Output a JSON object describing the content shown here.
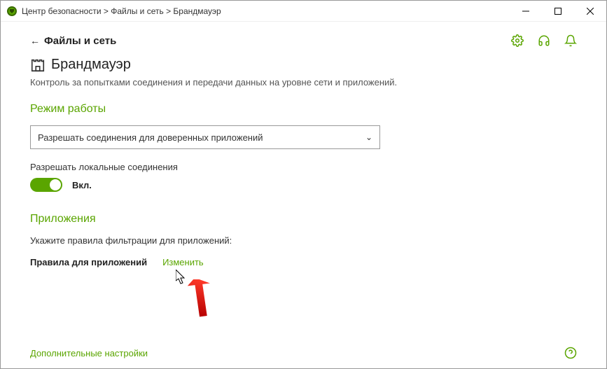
{
  "titlebar": {
    "breadcrumb": "Центр безопасности > Файлы и сеть > Брандмауэр"
  },
  "nav": {
    "back_label": "Файлы и сеть"
  },
  "page": {
    "title": "Брандмауэр",
    "description": "Контроль за попытками соединения и передачи данных на уровне сети и приложений."
  },
  "mode": {
    "section_title": "Режим работы",
    "dropdown_value": "Разрешать соединения для доверенных приложений",
    "allow_local_label": "Разрешать локальные соединения",
    "toggle_state_label": "Вкл."
  },
  "apps": {
    "section_title": "Приложения",
    "description": "Укажите правила фильтрации для приложений:",
    "rules_label": "Правила для приложений",
    "change_link": "Изменить"
  },
  "footer": {
    "advanced_link": "Дополнительные настройки"
  }
}
